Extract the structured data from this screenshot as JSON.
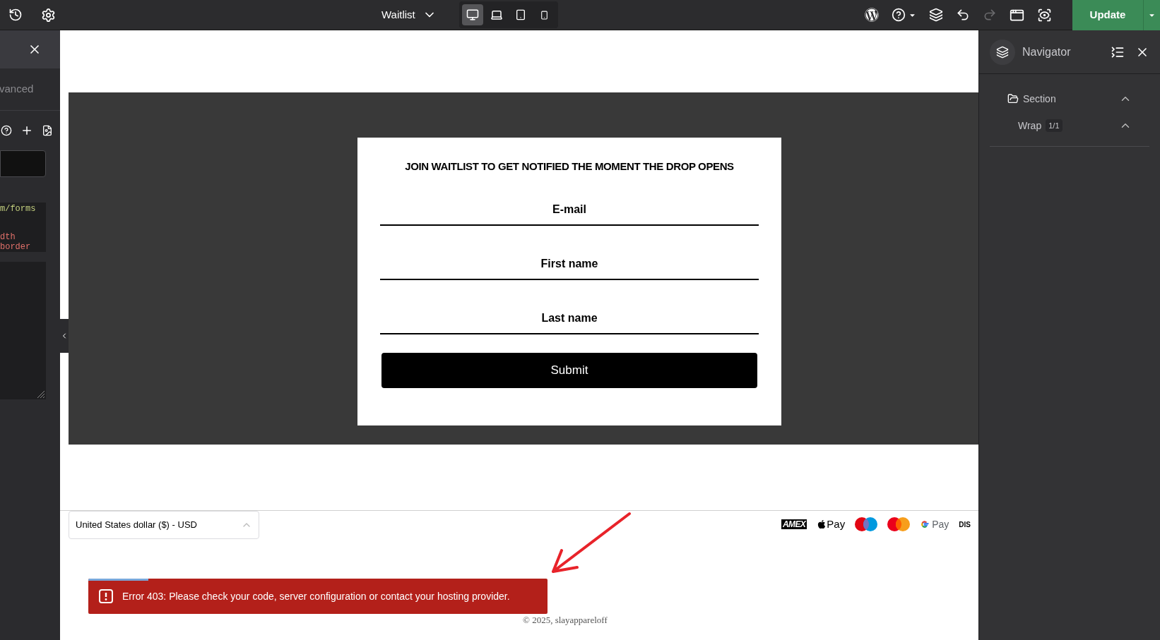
{
  "top_bar": {
    "page_title": "Waitlist",
    "devices": [
      {
        "kind": "desktop",
        "selected": true
      },
      {
        "kind": "laptop",
        "selected": false
      },
      {
        "kind": "tablet",
        "selected": false
      },
      {
        "kind": "mobile",
        "selected": false
      }
    ],
    "tools": [
      {
        "kind": "wordpress",
        "disabled": false
      },
      {
        "kind": "help",
        "disabled": false
      },
      {
        "kind": "layers",
        "disabled": false
      },
      {
        "kind": "undo",
        "disabled": false
      },
      {
        "kind": "redo",
        "disabled": true
      },
      {
        "kind": "responsive",
        "disabled": false
      },
      {
        "kind": "preview",
        "disabled": false
      }
    ],
    "update_button": "Update"
  },
  "left_panel": {
    "tab": "vanced",
    "code_lines": [
      {
        "text": "m/forms",
        "color": "#c3cf7e"
      },
      {
        "text": "dth",
        "color": "#e0706a"
      },
      {
        "text": "border",
        "color": "#e0706a"
      }
    ]
  },
  "form": {
    "title": "JOIN WAITLIST TO GET NOTIFIED THE MOMENT THE DROP OPENS",
    "fields": [
      {
        "placeholder": "E-mail"
      },
      {
        "placeholder": "First name"
      },
      {
        "placeholder": "Last name"
      }
    ],
    "submit": "Submit"
  },
  "footer": {
    "currency": "United States dollar ($) - USD",
    "payment_methods": [
      {
        "kind": "amex",
        "label": "AMEX"
      },
      {
        "kind": "applepay",
        "label": "Pay"
      },
      {
        "kind": "maestro"
      },
      {
        "kind": "mastercard"
      },
      {
        "kind": "gpay",
        "label": "Pay"
      },
      {
        "kind": "discover",
        "label": "DIS"
      }
    ],
    "copyright": "© 2025, slayappareloff"
  },
  "toast": {
    "message": "Error 403: Please check your code, server configuration or contact your hosting provider.",
    "level": 0.13
  },
  "navigator": {
    "title": "Navigator",
    "tree": [
      {
        "label": "Section",
        "expanded": true,
        "children": [
          {
            "label": "Wrap",
            "badge": "1/1",
            "expanded": true
          }
        ]
      }
    ]
  }
}
